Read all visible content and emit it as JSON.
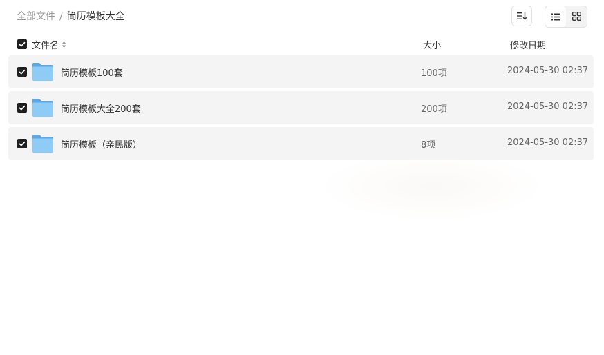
{
  "breadcrumb": {
    "root": "全部文件",
    "separator": "/",
    "current": "简历模板大全"
  },
  "toolbar": {
    "sort_icon": "sort-descending-icon",
    "view_list_icon": "list-view-icon",
    "view_grid_icon": "grid-view-icon",
    "active_view": "list"
  },
  "header": {
    "name": "文件名",
    "size": "大小",
    "date": "修改日期"
  },
  "files": [
    {
      "name": "简历模板100套",
      "size": "100项",
      "date": "2024-05-30 02:37",
      "checked": true,
      "icon": "folder-icon"
    },
    {
      "name": "简历模板大全200套",
      "size": "200项",
      "date": "2024-05-30 02:37",
      "checked": true,
      "icon": "folder-icon"
    },
    {
      "name": "简历模板（亲民版）",
      "size": "8项",
      "date": "2024-05-30 02:37",
      "checked": true,
      "icon": "folder-icon"
    }
  ],
  "colors": {
    "row_bg": "#f4f4f4",
    "checkbox": "#1f1f1f",
    "folder": "#7cc0f0"
  }
}
